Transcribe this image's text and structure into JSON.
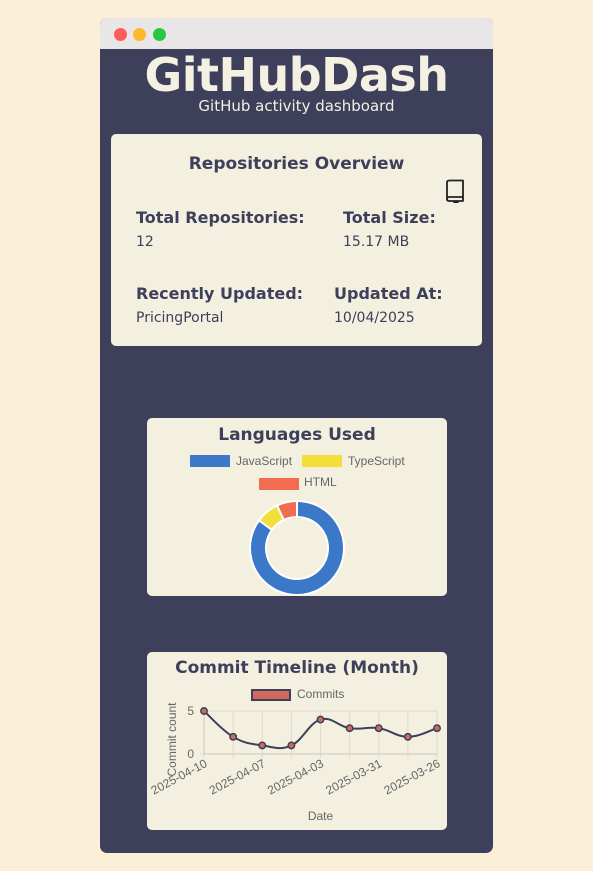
{
  "app": {
    "title": "GitHubDash",
    "subtitle": "GitHub activity dashboard"
  },
  "overview": {
    "title": "Repositories Overview",
    "total_repos_label": "Total Repositories:",
    "total_repos_value": "12",
    "total_size_label": "Total Size:",
    "total_size_value": "15.17 MB",
    "recent_label": "Recently Updated:",
    "recent_value": "PricingPortal",
    "updated_at_label": "Updated At:",
    "updated_at_value": "10/04/2025",
    "icon": "book-icon"
  },
  "languages": {
    "title": "Languages Used",
    "chart_data": {
      "type": "pie",
      "labels": [
        "JavaScript",
        "TypeScript",
        "HTML"
      ],
      "values": [
        85,
        8,
        7
      ],
      "colors": [
        "#3b78c8",
        "#f2df3c",
        "#f26c50"
      ]
    }
  },
  "commits": {
    "title": "Commit Timeline (Month)",
    "chart_data": {
      "type": "line",
      "series": [
        {
          "name": "Commits",
          "values": [
            5,
            2,
            1,
            1,
            4,
            3,
            3,
            2,
            3
          ]
        }
      ],
      "x_ticks": [
        "2025-04-10",
        "2025-04-07",
        "2025-04-03",
        "2025-03-31",
        "2025-03-26"
      ],
      "xlabel": "Date",
      "ylabel": "Commit count",
      "ylim": [
        0,
        5
      ],
      "y_ticks": [
        0,
        5
      ],
      "line_color": "#3d3f5b",
      "point_color": "#d06a5c"
    }
  }
}
